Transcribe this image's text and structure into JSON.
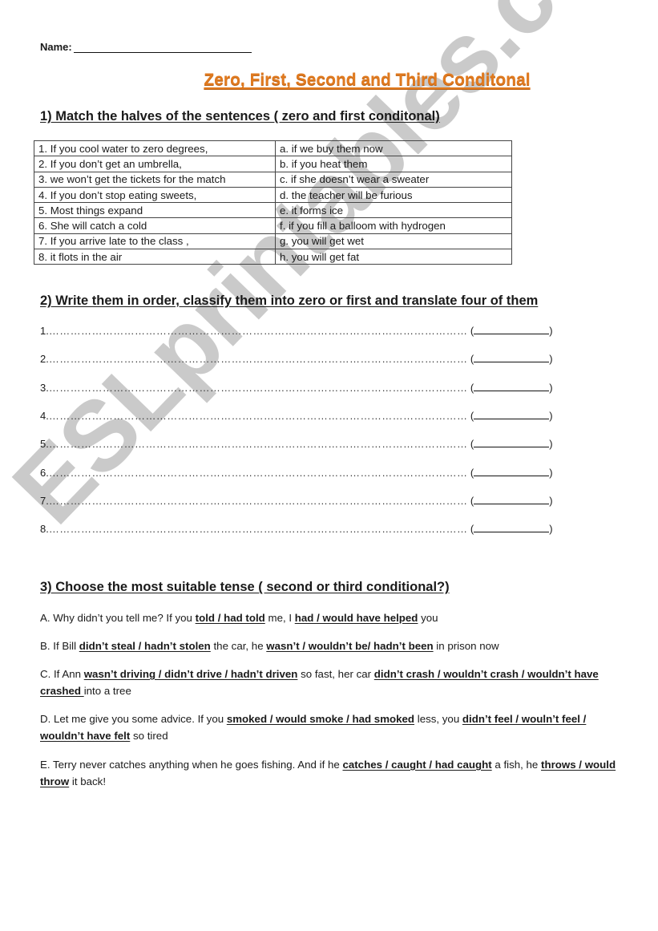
{
  "worksheet": {
    "name_label": "Name:",
    "title": "Zero, First,  Second and Third Conditonal",
    "title_color": "#e07a1f",
    "watermark": "ESLprintables.com"
  },
  "section1": {
    "heading": "1) Match the halves of the sentences ( zero and first conditonal)",
    "rows": [
      {
        "left": "1. If you cool water to zero degrees,",
        "right": "a. if we buy them now"
      },
      {
        "left": "2. If you don’t get an umbrella,",
        "right": "b. if you heat them"
      },
      {
        "left": "3. we won’t get the tickets for the match",
        "right": "c. if she doesn’t wear a sweater"
      },
      {
        "left": "4.  If you don’t stop eating sweets,",
        "right": "d. the teacher will be furious"
      },
      {
        "left": "5. Most things expand",
        "right": "e. it forms ice"
      },
      {
        "left": "6. She will catch a cold",
        "right": "f. if you fill a balloom with hydrogen"
      },
      {
        "left": "7. If you arrive late to the class ,",
        "right": "g. you will get wet"
      },
      {
        "left": "8. it flots in the air",
        "right": "h. you will get fat"
      }
    ]
  },
  "section2": {
    "heading": "2) Write them in order, classify them into zero or first and translate four of them",
    "lines": [
      "1.",
      "2.",
      "3.",
      "4.",
      "5.",
      "6.",
      "7.",
      "8."
    ],
    "dots": "…………………………………………………………………………………………………………………………………………………………",
    "paren_open": "(",
    "paren_close": ")"
  },
  "section3": {
    "heading": "3) Choose the most suitable tense ( second or third conditional?)",
    "questions": [
      {
        "parts": [
          {
            "t": "A. Why didn’t you tell me? If you ",
            "b": false
          },
          {
            "t": "told / had told",
            "b": true
          },
          {
            "t": " me, I ",
            "b": false
          },
          {
            "t": "had / would have helped",
            "b": true
          },
          {
            "t": " you",
            "b": false
          }
        ]
      },
      {
        "parts": [
          {
            "t": "B. If Bill ",
            "b": false
          },
          {
            "t": "didn’t steal / hadn’t stolen",
            "b": true
          },
          {
            "t": "  the car, he ",
            "b": false
          },
          {
            "t": "wasn’t / wouldn’t be/ hadn’t been",
            "b": true
          },
          {
            "t": " in prison now",
            "b": false
          }
        ]
      },
      {
        "parts": [
          {
            "t": "C. If Ann ",
            "b": false
          },
          {
            "t": "wasn’t driving / didn’t drive / hadn’t driven",
            "b": true
          },
          {
            "t": " so fast, her car ",
            "b": false
          },
          {
            "t": "didn’t crash / wouldn’t crash / wouldn’t have crashed ",
            "b": true
          },
          {
            "t": "into a tree",
            "b": false
          }
        ]
      },
      {
        "parts": [
          {
            "t": "D. Let me give you some advice. If you ",
            "b": false
          },
          {
            "t": "smoked / would smoke / had smoked",
            "b": true
          },
          {
            "t": " less, you ",
            "b": false
          },
          {
            "t": "didn’t feel / wouln’t feel / wouldn’t have felt",
            "b": true
          },
          {
            "t": " so tired",
            "b": false
          }
        ]
      },
      {
        "parts": [
          {
            "t": "E. Terry never catches anything when he goes fishing. And if he ",
            "b": false
          },
          {
            "t": "catches / caught / had caught",
            "b": true
          },
          {
            "t": " a fish, he ",
            "b": false
          },
          {
            "t": "throws / would throw",
            "b": true
          },
          {
            "t": " it back!",
            "b": false
          }
        ]
      }
    ]
  }
}
